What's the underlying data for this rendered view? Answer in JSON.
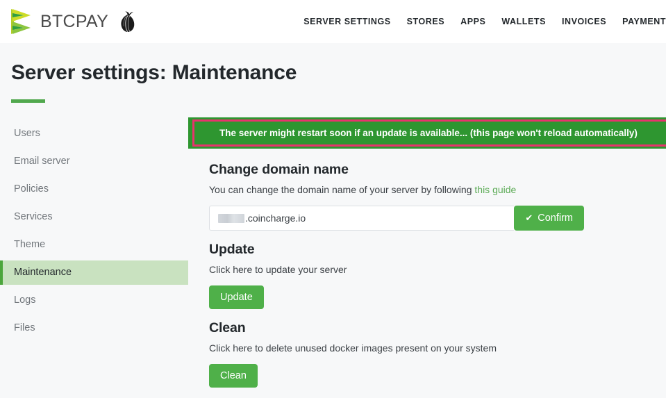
{
  "header": {
    "brand_name": "BTCPAY",
    "logo_icon": "btcpay-logo-icon",
    "onion_icon": "tor-onion-icon",
    "nav": [
      {
        "label": "SERVER SETTINGS"
      },
      {
        "label": "STORES"
      },
      {
        "label": "APPS"
      },
      {
        "label": "WALLETS"
      },
      {
        "label": "INVOICES"
      },
      {
        "label": "PAYMENT"
      }
    ]
  },
  "page": {
    "title": "Server settings: Maintenance"
  },
  "sidebar": {
    "items": [
      {
        "label": "Users",
        "active": false
      },
      {
        "label": "Email server",
        "active": false
      },
      {
        "label": "Policies",
        "active": false
      },
      {
        "label": "Services",
        "active": false
      },
      {
        "label": "Theme",
        "active": false
      },
      {
        "label": "Maintenance",
        "active": true
      },
      {
        "label": "Logs",
        "active": false
      },
      {
        "label": "Files",
        "active": false
      }
    ]
  },
  "alert": {
    "message": "The server might restart soon if an update is available... (this page won't reload automatically)",
    "background_color": "#2e9630",
    "annotation_border_color": "#e8336d"
  },
  "domain_section": {
    "title": "Change domain name",
    "description_prefix": "You can change the domain name of your server by following ",
    "link_label": "this guide",
    "input_value": ".coincharge.io",
    "input_redacted_prefix": true,
    "confirm_label": "Confirm",
    "confirm_icon": "check-icon"
  },
  "update_section": {
    "title": "Update",
    "description": "Click here to update your server",
    "button_label": "Update"
  },
  "clean_section": {
    "title": "Clean",
    "description": "Click here to delete unused docker images present on your system",
    "button_label": "Clean"
  },
  "colors": {
    "brand_green": "#4fb049",
    "accent_rule": "#51a84e",
    "active_nav_bg": "#c9e2c0",
    "link_green": "#5cab56",
    "page_bg": "#f7f8f9"
  }
}
